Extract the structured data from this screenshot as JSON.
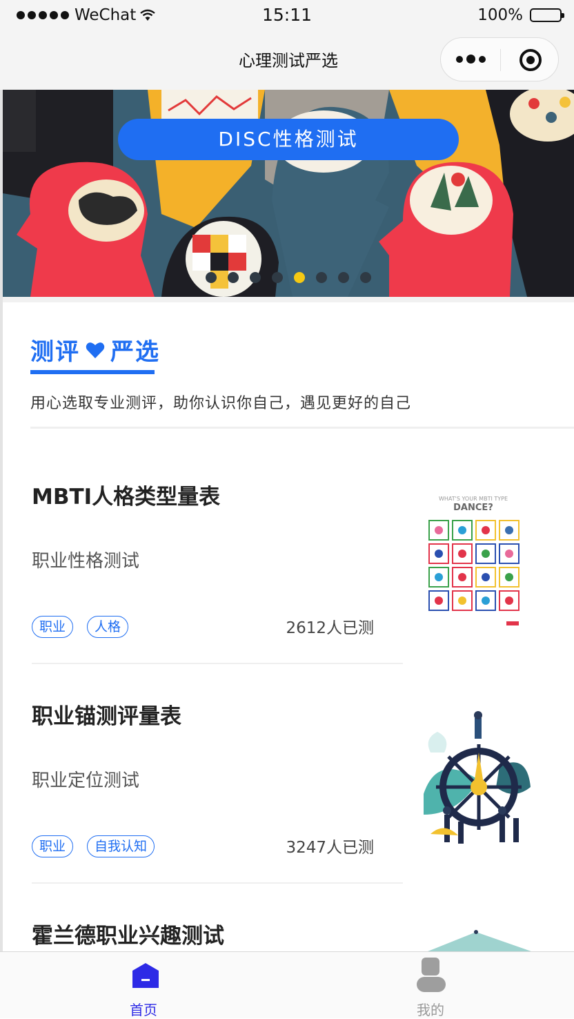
{
  "status_bar": {
    "carrier": "WeChat",
    "time": "15:11",
    "battery": "100%"
  },
  "nav": {
    "title": "心理测试严选"
  },
  "banner": {
    "button_label": "DISC性格测试",
    "page_count": 8,
    "active_page": 5
  },
  "section": {
    "title_left": "测评",
    "title_right": "严选",
    "subtitle": "用心选取专业测评，助你认识你自己，遇见更好的自己"
  },
  "tests": [
    {
      "title": "MBTI人格类型量表",
      "subtitle": "职业性格测试",
      "tags": [
        "职业",
        "人格"
      ],
      "count": "2612人已测",
      "thumb_text": [
        "WHAT'S YOUR MBTI TYPE",
        "DANCE?"
      ]
    },
    {
      "title": "职业锚测评量表",
      "subtitle": "职业定位测试",
      "tags": [
        "职业",
        "自我认知"
      ],
      "count": "3247人已测"
    },
    {
      "title": "霍兰德职业兴趣测试"
    }
  ],
  "tabbar": {
    "home": "首页",
    "me": "我的"
  },
  "colors": {
    "accent": "#1f6ef2",
    "tab_active": "#2d2ae6",
    "pager_active": "#f6c913"
  }
}
